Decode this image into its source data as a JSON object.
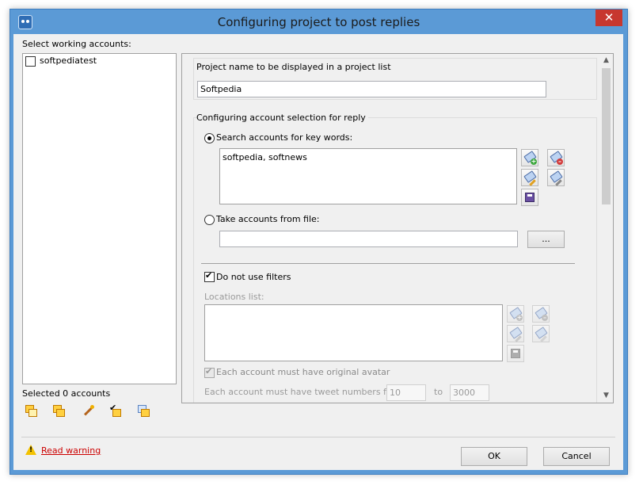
{
  "window": {
    "title": "Configuring project to post replies"
  },
  "left_panel": {
    "accounts_label": "Select working accounts:",
    "accounts": [
      {
        "name": "softpediatest",
        "checked": false
      }
    ],
    "selected_count": "Selected 0 accounts",
    "toolbar_icons": [
      "select-all-icon",
      "copy-icon",
      "magic-wand-icon",
      "check-selected-icon",
      "uncheck-icon"
    ]
  },
  "project": {
    "name_label": "Project name to be displayed in a project list",
    "name_value": "Softpedia"
  },
  "account_selection": {
    "group_label": "Configuring account selection for reply",
    "search_radio_label": "Search accounts for key words:",
    "search_selected": true,
    "keywords": "softpedia, softnews",
    "file_radio_label": "Take accounts from file:",
    "file_path": "",
    "browse_label": "..."
  },
  "filters": {
    "no_filters_label": "Do not use filters",
    "no_filters_checked": true,
    "locations_label": "Locations list:",
    "avatar_label": "Each account must have original avatar",
    "avatar_checked": true,
    "tweets_label": "Each account must have tweet numbers from:",
    "tweets_from": "10",
    "to_label": "to",
    "tweets_to": "3000"
  },
  "footer": {
    "warning_link": "Read warning",
    "ok_label": "OK",
    "cancel_label": "Cancel"
  },
  "colors": {
    "titlebar": "#5b9ad6",
    "close": "#c7372f",
    "link": "#cc0000"
  }
}
